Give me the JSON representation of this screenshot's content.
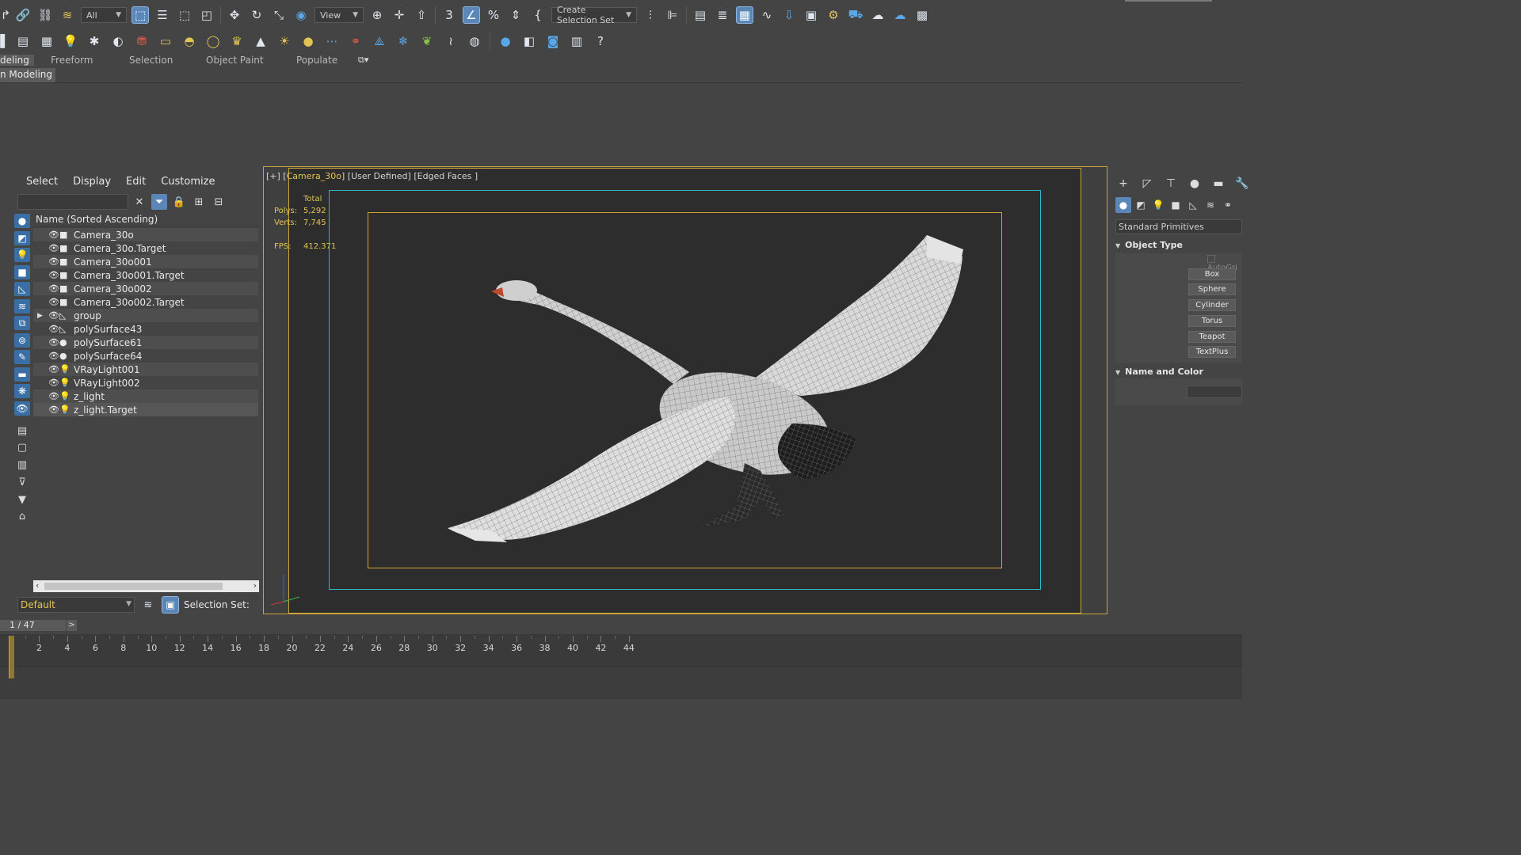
{
  "toolbar1": {
    "selection_filter": "All",
    "reference_coord": "View",
    "named_selection": "Create Selection Set"
  },
  "ribbon": {
    "tabs": [
      "deling",
      "Freeform",
      "Selection",
      "Object Paint",
      "Populate"
    ],
    "subtab": "n Modeling"
  },
  "scene_explorer": {
    "menu": [
      "Select",
      "Display",
      "Edit",
      "Customize"
    ],
    "column_header": "Name (Sorted Ascending)",
    "items": [
      {
        "name": "Camera_30o",
        "type": "camera"
      },
      {
        "name": "Camera_30o.Target",
        "type": "camera"
      },
      {
        "name": "Camera_30o001",
        "type": "camera"
      },
      {
        "name": "Camera_30o001.Target",
        "type": "camera"
      },
      {
        "name": "Camera_30o002",
        "type": "camera"
      },
      {
        "name": "Camera_30o002.Target",
        "type": "camera"
      },
      {
        "name": "group",
        "type": "helper",
        "expandable": true
      },
      {
        "name": "polySurface43",
        "type": "helper"
      },
      {
        "name": "polySurface61",
        "type": "geometry"
      },
      {
        "name": "polySurface64",
        "type": "geometry"
      },
      {
        "name": "VRayLight001",
        "type": "light"
      },
      {
        "name": "VRayLight002",
        "type": "light"
      },
      {
        "name": "z_light",
        "type": "light"
      },
      {
        "name": "z_light.Target",
        "type": "light"
      }
    ],
    "layer": "Default",
    "selection_set_label": "Selection Set:"
  },
  "viewport": {
    "label_prefix": "[+] [",
    "camera": "Camera_30o",
    "label_suffix": "] [User Defined] [Edged Faces ]",
    "stats": {
      "total_label": "Total",
      "polys_label": "Polys:",
      "polys": "5,292",
      "verts_label": "Verts:",
      "verts": "7,745",
      "fps_label": "FPS:",
      "fps": "412.371"
    }
  },
  "command_panel": {
    "category": "Standard Primitives",
    "object_type_title": "Object Type",
    "autogrid": "AutoGri",
    "buttons": [
      "Box",
      "Sphere",
      "Cylinder",
      "Torus",
      "Teapot",
      "TextPlus"
    ],
    "name_color_title": "Name and Color"
  },
  "timeline": {
    "frame": "1 / 47",
    "next": ">",
    "ruler_labels": [
      "2",
      "4",
      "6",
      "8",
      "10",
      "12",
      "14",
      "16",
      "18",
      "20",
      "22",
      "24",
      "26",
      "28",
      "30",
      "32",
      "34",
      "36",
      "38",
      "40",
      "42",
      "44"
    ]
  },
  "colors": {
    "accent": "#5a86b8",
    "viewport_border": "#c9a43a",
    "safe_frame": "#2fb6c4",
    "stats_text": "#e2c452"
  }
}
